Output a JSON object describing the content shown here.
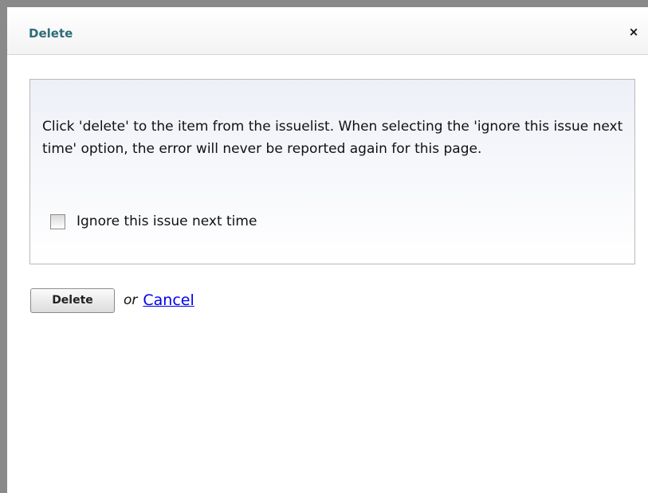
{
  "dialog": {
    "title": "Delete",
    "close_icon": "×",
    "message": "Click 'delete' to the item from the issuelist. When selecting the 'ignore this issue next time' option, the error will never be reported again for this page.",
    "option": {
      "label": "Ignore this issue next time",
      "checked": false
    },
    "actions": {
      "delete_label": "Delete",
      "or_label": "or",
      "cancel_label": "Cancel"
    }
  },
  "colors": {
    "title": "#2d6d78",
    "link": "#0000ee",
    "panel_top": "#eef0f8",
    "panel_border": "#b9b9b9"
  },
  "icons": {
    "close": "close-icon",
    "checkbox": "checkbox-icon"
  }
}
